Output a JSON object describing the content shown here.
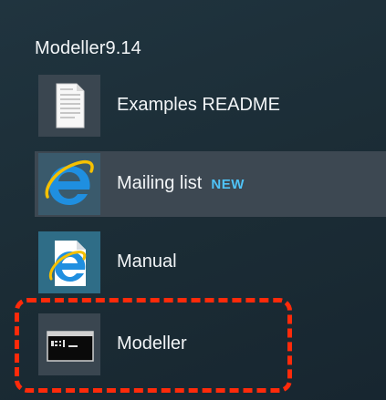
{
  "group": {
    "title": "Modeller9.14"
  },
  "items": [
    {
      "label": "Examples README",
      "icon": "document-icon"
    },
    {
      "label": "Mailing list",
      "badge": "NEW",
      "icon": "internet-explorer-icon"
    },
    {
      "label": "Manual",
      "icon": "internet-explorer-document-icon"
    },
    {
      "label": "Modeller",
      "icon": "command-prompt-icon"
    }
  ],
  "colors": {
    "background": "#1b2c35",
    "highlight": "#3d4852",
    "badge": "#4fc3f7",
    "annotation": "#ff2a0a"
  }
}
